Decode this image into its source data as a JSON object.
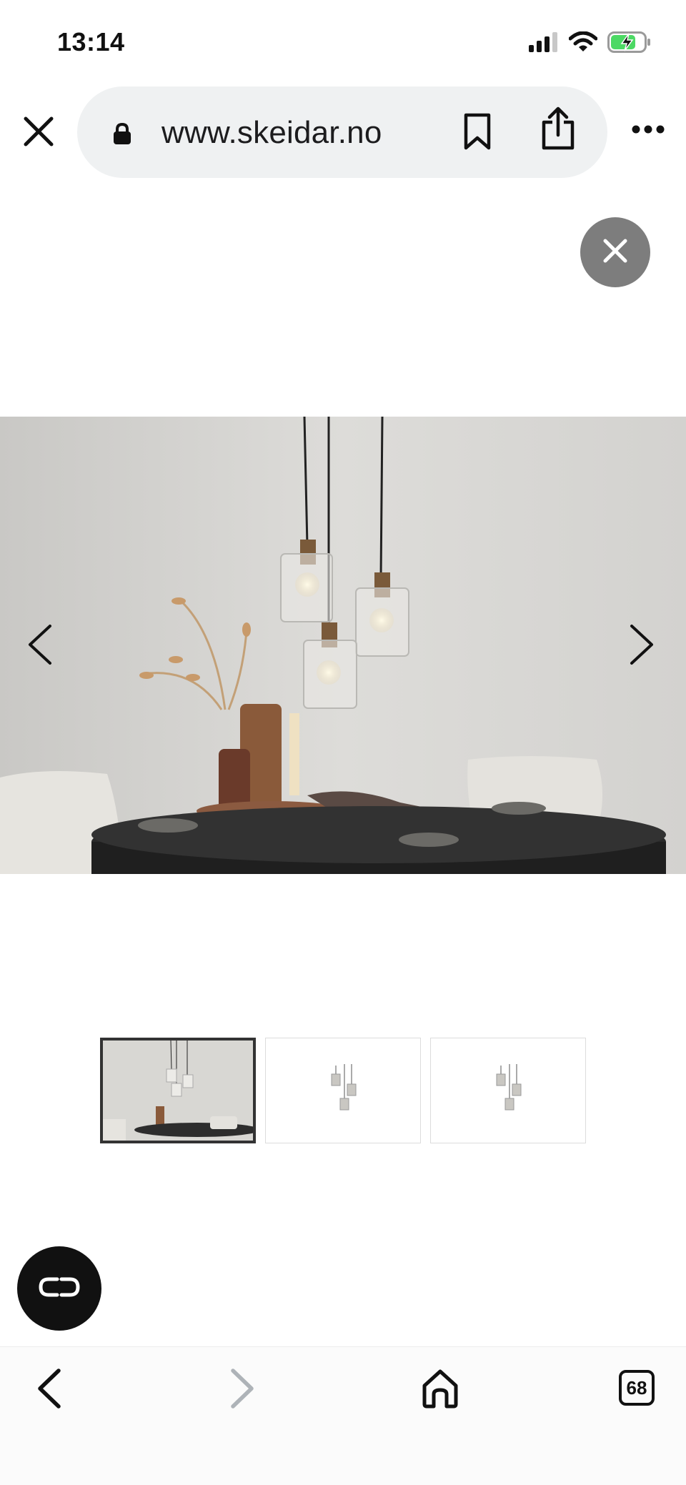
{
  "status_bar": {
    "time": "13:14",
    "icons": [
      "cellular-signal-icon",
      "wifi-icon",
      "battery-charging-icon"
    ]
  },
  "browser": {
    "url": "www.skeidar.no",
    "icons": [
      "close-icon",
      "lock-icon",
      "bookmark-icon",
      "share-icon",
      "more-icon"
    ]
  },
  "gallery": {
    "selected_index": 0,
    "thumbnails": [
      "thumbnail-1",
      "thumbnail-2",
      "thumbnail-3"
    ],
    "icons": [
      "close-icon",
      "chevron-left-icon",
      "chevron-right-icon"
    ]
  },
  "chat": {
    "icon": "chat-icon"
  },
  "bottom_nav": {
    "tab_count": "68",
    "icons": [
      "back-icon",
      "forward-icon",
      "home-icon",
      "tabs-icon"
    ]
  },
  "colors": {
    "url_pill": "#eff1f2",
    "overlay_close": "#7d7d7d",
    "thumb_active_border": "#333333",
    "fab": "#111111"
  }
}
